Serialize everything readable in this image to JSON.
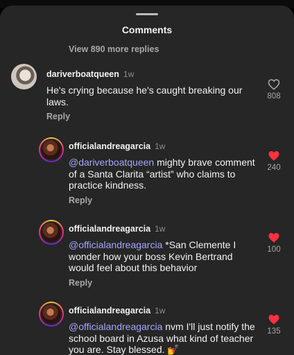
{
  "header": {
    "title": "Comments",
    "view_more": "View 890 more replies"
  },
  "comments": [
    {
      "username": "dariverboatqueen",
      "time": "1w",
      "mention": "",
      "text": "He's crying because he's caught breaking our laws.",
      "reply_label": "Reply",
      "likes": "808",
      "liked": false
    },
    {
      "username": "officialandreagarcia",
      "time": "1w",
      "mention": "@dariverboatqueen",
      "text": " mighty brave comment of a Santa Clarita “artist” who claims to practice kindness.",
      "reply_label": "Reply",
      "likes": "240",
      "liked": true
    },
    {
      "username": "officialandreagarcia",
      "time": "1w",
      "mention": "@officialandreagarcia",
      "text": " *San Clemente I wonder how your boss Kevin Bertrand would feel about this behavior",
      "reply_label": "Reply",
      "likes": "100",
      "liked": true
    },
    {
      "username": "officialandreagarcia",
      "time": "1w",
      "mention": "@officialandreagarcia",
      "text": " nvm I'll just notify the school board in Azusa what kind of teacher you are. Stay blessed. 💅",
      "reply_label": "",
      "likes": "135",
      "liked": true
    }
  ],
  "colors": {
    "sheet_bg": "#262626",
    "mention": "#a3a7ff",
    "like_red": "#ff3040",
    "muted": "#a8a8a8"
  },
  "icons": {
    "like_outline": "heart-outline-icon",
    "like_filled": "heart-filled-icon"
  }
}
